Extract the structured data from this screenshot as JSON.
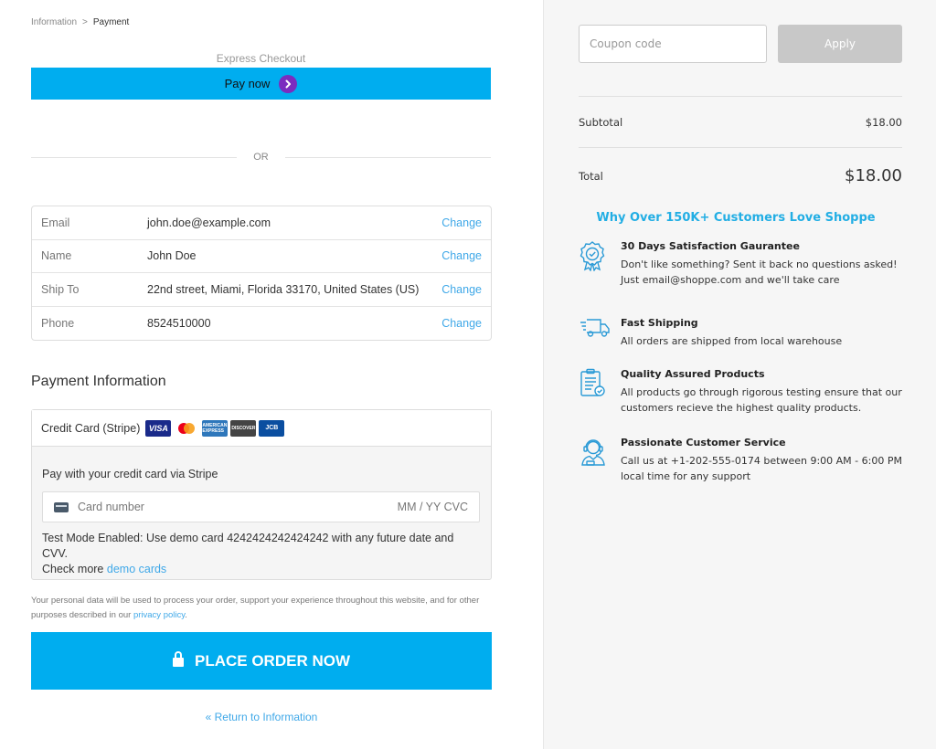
{
  "breadcrumb": {
    "first": "Information",
    "separator": ">",
    "current": "Payment"
  },
  "express": {
    "label": "Express Checkout",
    "pay_now": "Pay now"
  },
  "divider": {
    "text": "OR"
  },
  "review": {
    "change_label": "Change",
    "rows": [
      {
        "label": "Email",
        "value": "john.doe@example.com"
      },
      {
        "label": "Name",
        "value": "John Doe"
      },
      {
        "label": "Ship To",
        "value": "22nd street, Miami, Florida 33170, United States (US)"
      },
      {
        "label": "Phone",
        "value": "8524510000"
      }
    ]
  },
  "payment": {
    "title": "Payment Information",
    "method_label": "Credit Card (Stripe)",
    "card_logos": [
      "VISA",
      "mastercard",
      "AMERICAN EXPRESS",
      "DISCOVER",
      "JCB"
    ],
    "subtitle": "Pay with your credit card via Stripe",
    "card_placeholder": "Card number",
    "card_right": "MM / YY  CVC",
    "note": "Test Mode Enabled: Use demo card 4242424242424242 with any future date and CVV.",
    "note_more": "Check more",
    "note_link": "demo cards"
  },
  "privacy": {
    "text": "Your personal data will be used to process your order, support your experience throughout this website, and for other purposes described in our",
    "link": "privacy policy",
    "end": "."
  },
  "place_order": {
    "label": "PLACE ORDER NOW"
  },
  "return_link": {
    "label": "« Return to Information"
  },
  "summary": {
    "coupon_placeholder": "Coupon code",
    "apply_label": "Apply",
    "subtotal_label": "Subtotal",
    "subtotal_value": "$18.00",
    "total_label": "Total",
    "total_value": "$18.00"
  },
  "why": {
    "title": "Why Over 150K+ Customers Love Shoppe",
    "features": [
      {
        "icon": "satisfaction-badge-icon",
        "title": "30 Days Satisfaction Gaurantee",
        "desc": "Don't like something? Sent it back no questions asked! Just email@shoppe.com and we'll take care"
      },
      {
        "icon": "delivery-truck-icon",
        "title": "Fast Shipping",
        "desc": "All orders are shipped from local warehouse"
      },
      {
        "icon": "quality-clipboard-icon",
        "title": "Quality Assured Products",
        "desc": "All products go through rigorous testing ensure that our customers recieve the highest quality products."
      },
      {
        "icon": "customer-service-icon",
        "title": "Passionate Customer Service",
        "desc": "Call us at +1-202-555-0174 between 9:00 AM - 6:00 PM local time for any support"
      }
    ]
  },
  "colors": {
    "accent": "#00adef",
    "link": "#3fa8e8",
    "why_title": "#22aee4",
    "pay_circle": "#7b2cbf",
    "sidebar_bg": "#f6f6f6"
  }
}
